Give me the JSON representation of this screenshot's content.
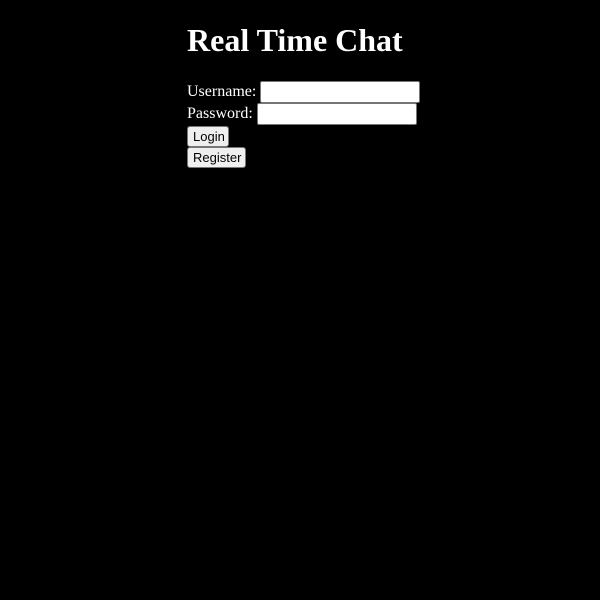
{
  "page": {
    "title": "Real Time Chat"
  },
  "form": {
    "username_label": "Username:",
    "username_value": "",
    "password_label": "Password:",
    "password_value": "",
    "login_label": "Login",
    "register_label": "Register"
  },
  "colors": {
    "background": "#000000",
    "text": "#ffffff",
    "button_bg": "#efefef",
    "input_bg": "#ffffff"
  }
}
